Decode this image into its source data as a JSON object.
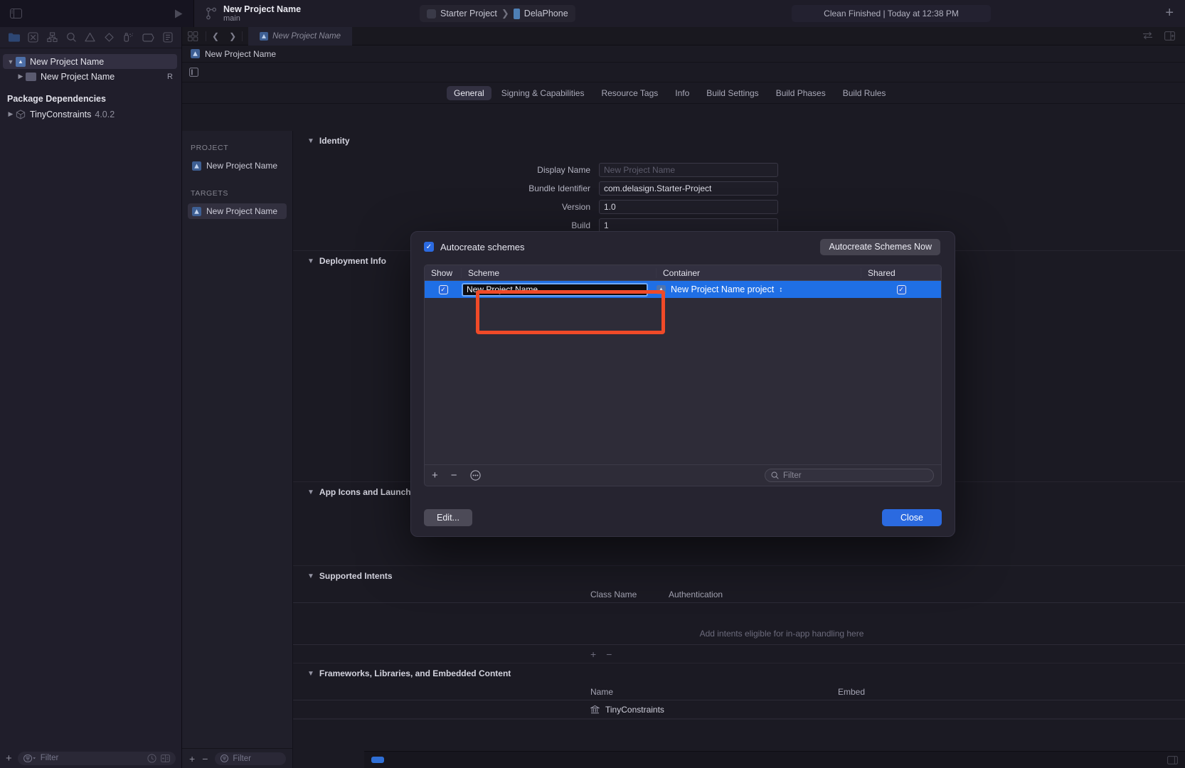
{
  "toolbar": {
    "scheme_name": "New Project Name",
    "branch": "main",
    "destination_project": "Starter Project",
    "destination_device": "DelaPhone",
    "status": "Clean Finished | Today at 12:38 PM",
    "add_icon": "plus-icon",
    "run_icon": "run-triangle-icon",
    "sidebar_toggle_icon": "left-panel-toggle-icon"
  },
  "navigator": {
    "icons": [
      {
        "name": "folder-icon",
        "selected": true
      },
      {
        "name": "source-control-icon",
        "selected": false
      },
      {
        "name": "symbol-hierarchy-icon",
        "selected": false
      },
      {
        "name": "search-icon",
        "selected": false
      },
      {
        "name": "issue-warning-icon",
        "selected": false
      },
      {
        "name": "test-diamond-icon",
        "selected": false
      },
      {
        "name": "debug-spray-icon",
        "selected": false
      },
      {
        "name": "breakpoint-tag-icon",
        "selected": false
      },
      {
        "name": "report-list-icon",
        "selected": false
      }
    ],
    "items": [
      {
        "label": "New Project Name",
        "icon": "project-icon",
        "indent": 0,
        "selected": true,
        "disclosure": "down",
        "badge": ""
      },
      {
        "label": "New Project Name",
        "icon": "folder-icon",
        "indent": 1,
        "selected": false,
        "disclosure": "right",
        "badge": "R"
      }
    ],
    "group_title": "Package Dependencies",
    "packages": [
      {
        "label": "TinyConstraints",
        "version": "4.0.2",
        "icon": "package-icon",
        "disclosure": "right"
      }
    ],
    "footer": {
      "add_icon": "plus-icon",
      "filter_placeholder": "Filter",
      "recent_icon": "clock-icon",
      "source-control_icon": "source-control-filter-icon"
    }
  },
  "jumpbar": {
    "grid_icon": "grid-icon",
    "back_icon": "chevron-left-icon",
    "forward_icon": "chevron-right-icon",
    "tab_label": "New Project Name",
    "swap_icon": "swap-editors-icon",
    "panel_icon": "add-editor-icon"
  },
  "breadcrumb": {
    "label": "New Project Name",
    "icon": "project-icon"
  },
  "secondbar": {
    "icon": "minimap-toggle-icon"
  },
  "inspector_tabs": [
    {
      "label": "General",
      "active": true
    },
    {
      "label": "Signing & Capabilities",
      "active": false
    },
    {
      "label": "Resource Tags",
      "active": false
    },
    {
      "label": "Info",
      "active": false
    },
    {
      "label": "Build Settings",
      "active": false
    },
    {
      "label": "Build Phases",
      "active": false
    },
    {
      "label": "Build Rules",
      "active": false
    }
  ],
  "project_list": {
    "project_header": "PROJECT",
    "project_items": [
      {
        "label": "New Project Name",
        "selected": false
      }
    ],
    "targets_header": "TARGETS",
    "target_items": [
      {
        "label": "New Project Name",
        "selected": true
      }
    ],
    "footer": {
      "add_icon": "plus-icon",
      "remove_icon": "minus-icon",
      "filter_placeholder": "Filter"
    }
  },
  "detail": {
    "identity": {
      "title": "Identity",
      "fields": [
        {
          "label": "Display Name",
          "value": "New Project Name",
          "placeholder": true
        },
        {
          "label": "Bundle Identifier",
          "value": "com.delasign.Starter-Project",
          "placeholder": false
        },
        {
          "label": "Version",
          "value": "1.0",
          "placeholder": false
        },
        {
          "label": "Build",
          "value": "1",
          "placeholder": false
        }
      ]
    },
    "deployment_info": {
      "title": "Deployment Info"
    },
    "app_icons": {
      "title": "App Icons and Launch Screen"
    },
    "supported_intents": {
      "title": "Supported Intents",
      "columns": [
        "Class Name",
        "Authentication"
      ],
      "empty_text": "Add intents eligible for in-app handling here",
      "add_icon": "plus-icon",
      "remove_icon": "minus-icon"
    },
    "frameworks": {
      "title": "Frameworks, Libraries, and Embedded Content",
      "columns": [
        "Name",
        "Embed"
      ],
      "rows": [
        {
          "name": "TinyConstraints",
          "icon": "library-icon",
          "embed": ""
        }
      ]
    }
  },
  "modal": {
    "autocreate_label": "Autocreate schemes",
    "autocreate_checked": true,
    "autocreate_button": "Autocreate Schemes Now",
    "columns": {
      "show": "Show",
      "scheme": "Scheme",
      "container": "Container",
      "shared": "Shared"
    },
    "rows": [
      {
        "show_checked": true,
        "scheme_name": "New Project Name",
        "editing": true,
        "container": "New Project Name project",
        "container_icon": "project-icon",
        "container_chevron": "updown-chevron-icon",
        "shared_checked": true
      }
    ],
    "footer": {
      "add_icon": "plus-icon",
      "remove_icon": "minus-icon",
      "more_icon": "ellipsis-circle-icon",
      "filter_placeholder": "Filter",
      "search_icon": "search-icon"
    },
    "edit_button": "Edit...",
    "close_button": "Close",
    "highlight_color": "#f04a28"
  },
  "bottom_bar": {
    "chip_icon": "console-chip-icon",
    "right_icon": "panel-toggle-icon"
  },
  "colors": {
    "accent_blue": "#2b6ae0",
    "selection_blue": "#1f6fe5",
    "highlight_orange": "#f04a28",
    "window_bg": "#1d1b27"
  }
}
